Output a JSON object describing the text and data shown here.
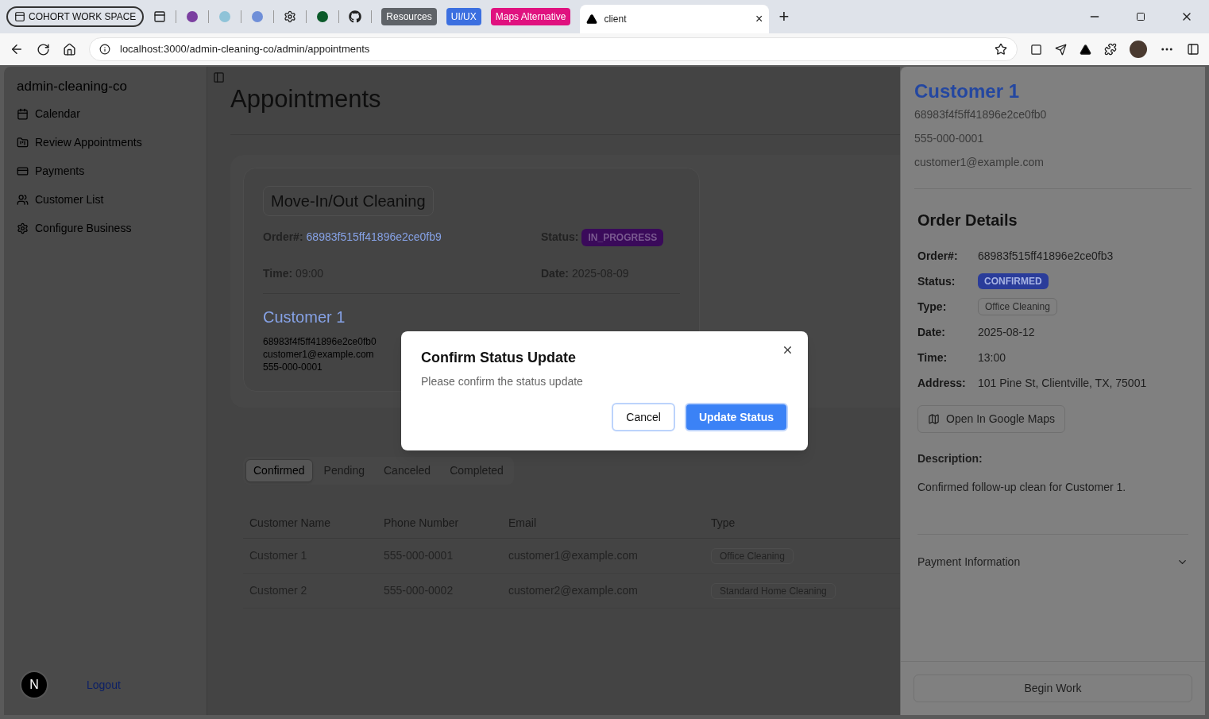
{
  "browser": {
    "tab_group": "COHORT WORK SPACE",
    "labeled_tabs": [
      {
        "label": "Resources",
        "color": "#5f6368"
      },
      {
        "label": "UI/UX",
        "color": "#3b6fe0"
      },
      {
        "label": "Maps Alternative",
        "color": "#e0117f"
      }
    ],
    "active_tab": {
      "title": "client",
      "close": "×"
    },
    "new_tab": "+",
    "url": "localhost:3000/admin-cleaning-co/admin/appointments"
  },
  "sidebar": {
    "title": "admin-cleaning-co",
    "items": [
      {
        "label": "Calendar"
      },
      {
        "label": "Review Appointments"
      },
      {
        "label": "Payments"
      },
      {
        "label": "Customer List"
      },
      {
        "label": "Configure Business"
      }
    ],
    "avatar": "N",
    "logout": "Logout"
  },
  "main": {
    "title": "Appointments",
    "current": {
      "type": "Move-In/Out Cleaning",
      "order_label": "Order#:",
      "order": "68983f515ff41896e2ce0fb9",
      "status_label": "Status:",
      "status": "IN_PROGRESS",
      "time_label": "Time:",
      "time": "09:00",
      "date_label": "Date:",
      "date": "2025-08-09",
      "customer": {
        "name": "Customer 1",
        "id": "68983f4f5ff41896e2ce0fb0",
        "email": "customer1@example.com",
        "phone": "555-000-0001"
      }
    },
    "tabs": [
      {
        "label": "Confirmed",
        "selected": true
      },
      {
        "label": "Pending",
        "selected": false
      },
      {
        "label": "Canceled",
        "selected": false
      },
      {
        "label": "Completed",
        "selected": false
      }
    ],
    "table": {
      "columns": [
        "Customer Name",
        "Phone Number",
        "Email",
        "Type"
      ],
      "rows": [
        {
          "cells": [
            "Customer 1",
            "555-000-0001",
            "customer1@example.com"
          ],
          "type": "Office Cleaning"
        },
        {
          "cells": [
            "Customer 2",
            "555-000-0002",
            "customer2@example.com"
          ],
          "type": "Standard Home Cleaning"
        }
      ]
    }
  },
  "panel": {
    "customer": {
      "name": "Customer 1",
      "id": "68983f4f5ff41896e2ce0fb0",
      "phone": "555-000-0001",
      "email": "customer1@example.com"
    },
    "heading": "Order Details",
    "fields": [
      {
        "label": "Order#:",
        "value": "68983f515ff41896e2ce0fb3",
        "kind": "text"
      },
      {
        "label": "Status:",
        "value": "CONFIRMED",
        "kind": "badge"
      },
      {
        "label": "Type:",
        "value": "Office Cleaning",
        "kind": "chip"
      },
      {
        "label": "Date:",
        "value": "2025-08-12",
        "kind": "text"
      },
      {
        "label": "Time:",
        "value": "13:00",
        "kind": "text"
      },
      {
        "label": "Address:",
        "value": "101 Pine St, Clientville, TX, 75001",
        "kind": "text"
      }
    ],
    "maps_button": "Open In Google Maps",
    "description_label": "Description:",
    "description": "Confirmed follow-up clean for Customer 1.",
    "payment": {
      "label": "Payment Information",
      "expanded": false
    },
    "action": "Begin Work"
  },
  "dialog": {
    "title": "Confirm Status Update",
    "message": "Please confirm the status update",
    "buttons": [
      {
        "label": "Cancel",
        "kind": "secondary"
      },
      {
        "label": "Update Status",
        "kind": "primary"
      }
    ]
  }
}
